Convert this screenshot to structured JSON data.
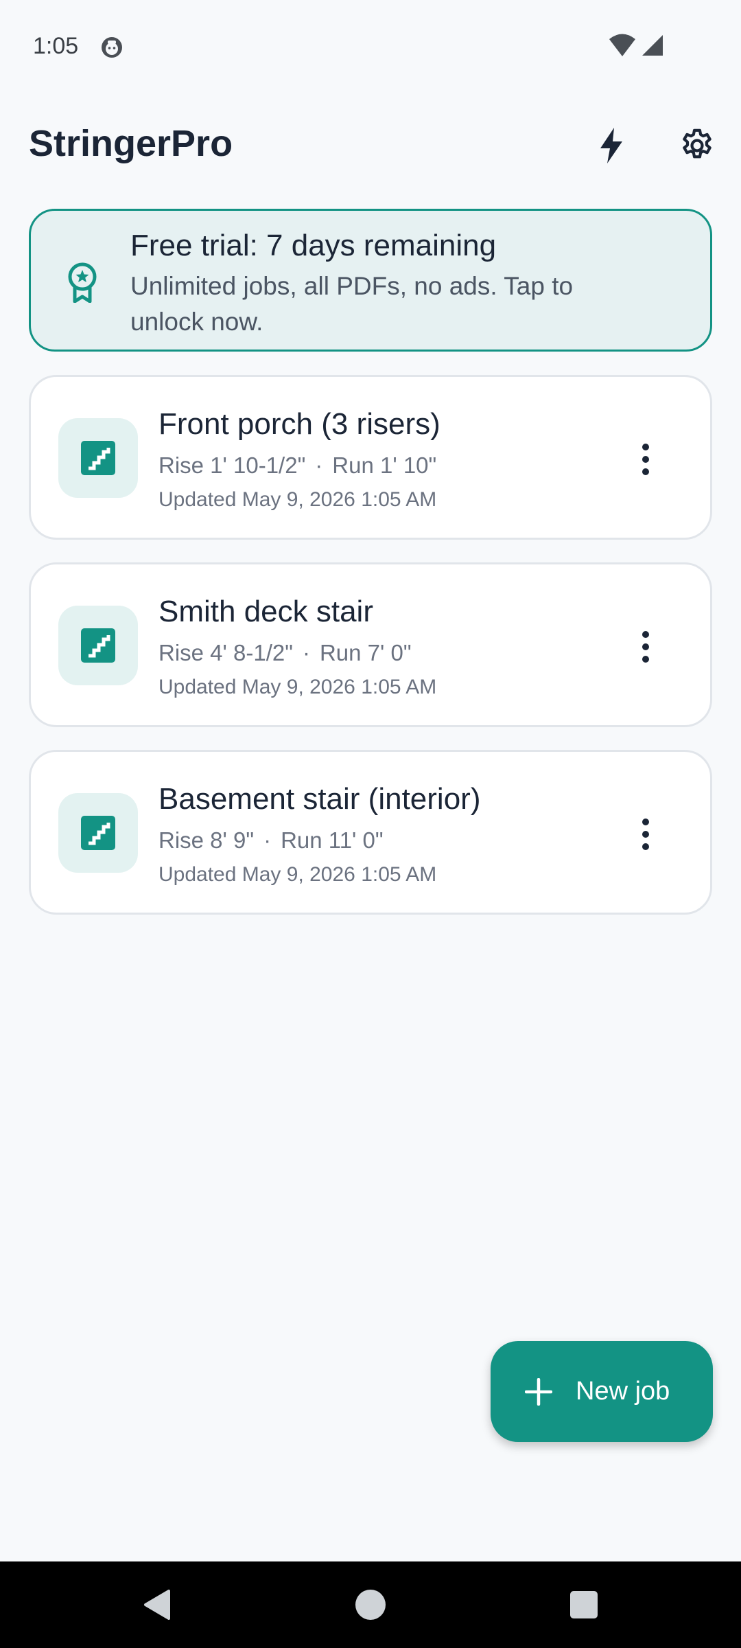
{
  "status_bar": {
    "time": "1:05"
  },
  "app_bar": {
    "title": "StringerPro"
  },
  "trial_banner": {
    "title": "Free trial: 7 days remaining",
    "description": "Unlimited jobs, all PDFs, no ads. Tap to unlock now.",
    "icon": "award-ribbon-icon"
  },
  "jobs": [
    {
      "title": "Front porch (3 risers)",
      "rise": "Rise 1' 10-1/2\"",
      "run": "Run 1' 10\"",
      "separator": "·",
      "updated": "Updated May 9, 2026 1:05 AM"
    },
    {
      "title": "Smith deck stair",
      "rise": "Rise 4' 8-1/2\"",
      "run": "Run 7' 0\"",
      "separator": "·",
      "updated": "Updated May 9, 2026 1:05 AM"
    },
    {
      "title": "Basement stair (interior)",
      "rise": "Rise 8' 9\"",
      "run": "Run 11' 0\"",
      "separator": "·",
      "updated": "Updated May 9, 2026 1:05 AM"
    }
  ],
  "fab": {
    "label": "New job"
  },
  "colors": {
    "accent": "#139384",
    "banner_bg": "#e6f1f2",
    "icon_bg": "#e3f2f1",
    "background": "#f7f9fb"
  }
}
